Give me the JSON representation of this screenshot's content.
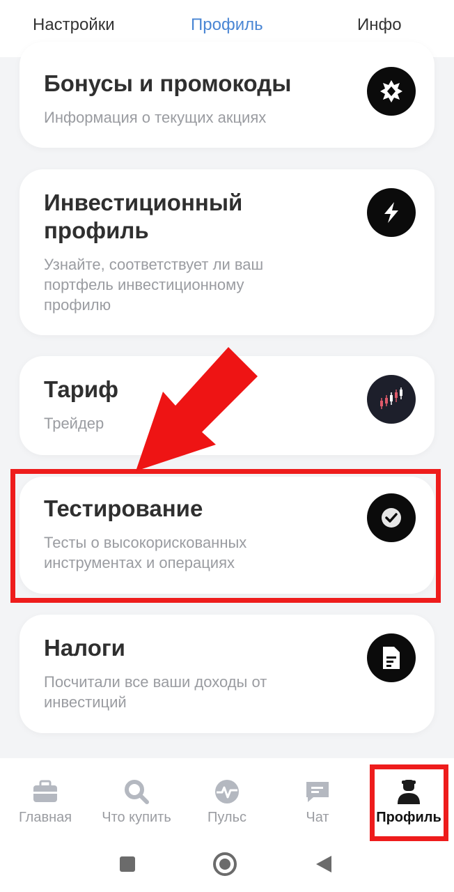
{
  "top_tabs": [
    {
      "label": "Настройки",
      "active": false
    },
    {
      "label": "Профиль",
      "active": true
    },
    {
      "label": "Инфо",
      "active": false
    }
  ],
  "cards": [
    {
      "title": "Бонусы и промокоды",
      "subtitle": "Информация о текущих акциях",
      "icon": "badge-icon"
    },
    {
      "title": "Инвестиционный профиль",
      "subtitle": "Узнайте, соответствует ли ваш портфель инвестиционному профилю",
      "icon": "lightning-icon"
    },
    {
      "title": "Тариф",
      "subtitle": "Трейдер",
      "icon": "candlestick-icon"
    },
    {
      "title": "Тестирование",
      "subtitle": "Тесты о высокорискованных инструментах и операциях",
      "icon": "check-icon"
    },
    {
      "title": "Налоги",
      "subtitle": "Посчитали все ваши доходы от инвестиций",
      "icon": "document-icon"
    }
  ],
  "bottom_nav": [
    {
      "label": "Главная",
      "icon": "briefcase-icon",
      "active": false
    },
    {
      "label": "Что купить",
      "icon": "search-icon",
      "active": false
    },
    {
      "label": "Пульс",
      "icon": "pulse-icon",
      "active": false
    },
    {
      "label": "Чат",
      "icon": "chat-icon",
      "active": false
    },
    {
      "label": "Профиль",
      "icon": "person-icon",
      "active": true
    }
  ],
  "colors": {
    "accent": "#4a86d4",
    "highlight": "#ee1c1c",
    "icon_bg": "#0b0b0b",
    "muted_text": "#9a9ca1"
  }
}
